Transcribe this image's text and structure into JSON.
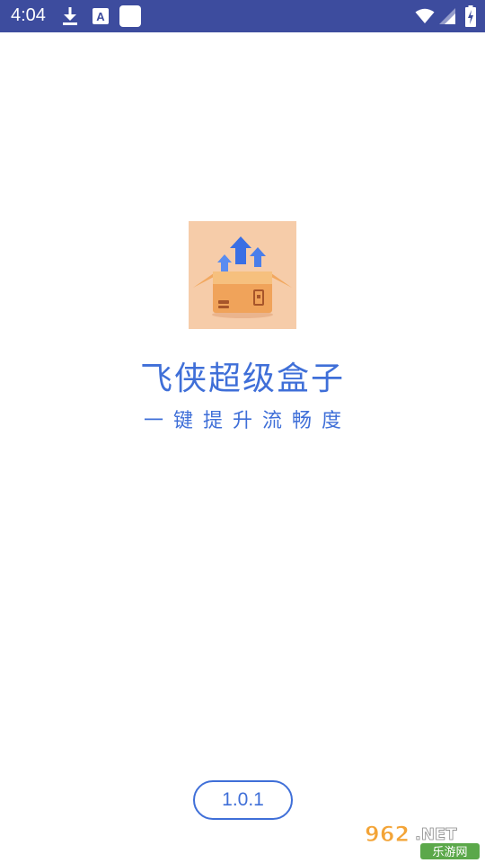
{
  "status_bar": {
    "time": "4:04",
    "background_color": "#3d4c9e",
    "icons": [
      "download-icon",
      "text-a-icon",
      "notification-square-icon",
      "wifi-icon",
      "signal-icon",
      "battery-charging-icon"
    ]
  },
  "splash": {
    "logo_icon": "box-with-upward-arrows-icon",
    "app_name": "飞侠超级盒子",
    "slogan": "一键提升流畅度",
    "accent_color": "#3f6fd8"
  },
  "footer": {
    "version": "1.0.1"
  },
  "watermark": {
    "brand": "962",
    "domain": ".NET",
    "caption": "乐游网"
  }
}
